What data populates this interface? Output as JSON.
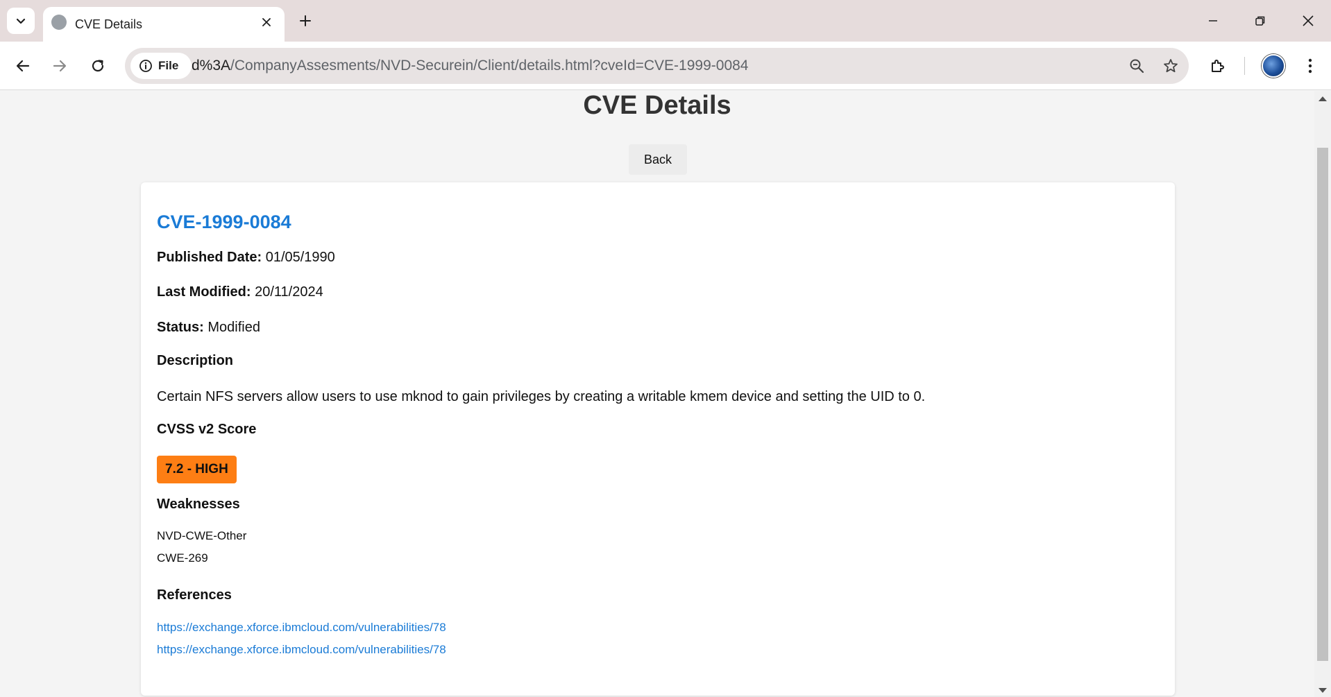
{
  "browser": {
    "tab_title": "CVE Details",
    "site_chip_label": "File",
    "url_prefix": "d%3A",
    "url_rest": "/CompanyAssesments/NVD-Securein/Client/details.html?cveId=CVE-1999-0084"
  },
  "page": {
    "title": "CVE Details",
    "back_label": "Back"
  },
  "cve": {
    "id": "CVE-1999-0084",
    "published_label": "Published Date:",
    "published_value": "01/05/1990",
    "modified_label": "Last Modified:",
    "modified_value": "20/11/2024",
    "status_label": "Status:",
    "status_value": "Modified",
    "description_heading": "Description",
    "description": "Certain NFS servers allow users to use mknod to gain privileges by creating a writable kmem device and setting the UID to 0.",
    "cvss_heading": "CVSS v2 Score",
    "cvss_badge": "7.2 - HIGH",
    "cvss_color": "#fd7e14",
    "weaknesses_heading": "Weaknesses",
    "weaknesses": [
      "NVD-CWE-Other",
      "CWE-269"
    ],
    "references_heading": "References",
    "references": [
      "https://exchange.xforce.ibmcloud.com/vulnerabilities/78",
      "https://exchange.xforce.ibmcloud.com/vulnerabilities/78"
    ]
  },
  "colors": {
    "link": "#1a7bd6",
    "tabbar_bg": "#e6dcdc"
  }
}
